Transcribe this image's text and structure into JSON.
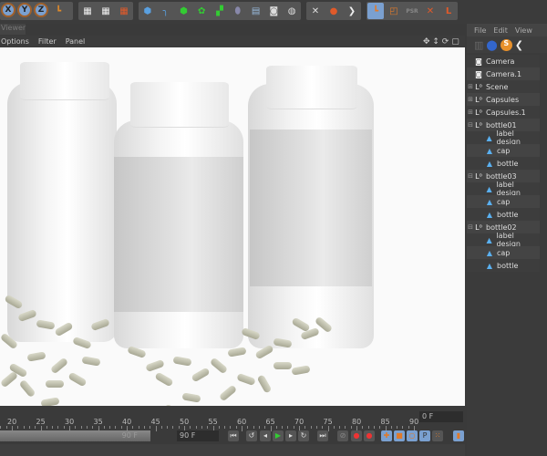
{
  "toolbar": {
    "axis_buttons": [
      "X",
      "Y",
      "Z"
    ],
    "icons": [
      "coordinate-system-icon",
      "render-view-icon",
      "render-picture-viewer-icon",
      "edit-render-settings-icon",
      "cube-icon",
      "spline-pen-icon",
      "subdivision-surface-icon",
      "array-icon",
      "mograph-cloner-icon",
      "deformer-icon",
      "floor-icon",
      "camera-icon",
      "light-icon",
      "snap-icon",
      "workplane-icon",
      "more-arrow-icon",
      "model-mode-icon",
      "texture-mode-icon",
      "psr-icon",
      "axis-mode-icon",
      "workplane-mode-icon"
    ]
  },
  "viewer": {
    "tab": "Viewer",
    "menu": [
      "Options",
      "Filter",
      "Panel"
    ]
  },
  "outliner": {
    "menu": [
      "File",
      "Edit",
      "View"
    ],
    "items": [
      {
        "label": "Camera",
        "icon": "camera-icon",
        "level": 0
      },
      {
        "label": "Camera.1",
        "icon": "camera-icon",
        "level": 0
      },
      {
        "label": "Scene",
        "icon": "null-object-icon",
        "level": 0,
        "expand": "+"
      },
      {
        "label": "Capsules",
        "icon": "null-object-icon",
        "level": 0,
        "expand": "+"
      },
      {
        "label": "Capsules.1",
        "icon": "null-object-icon",
        "level": 0,
        "expand": "+"
      },
      {
        "label": "bottle01",
        "icon": "null-object-icon",
        "level": 0,
        "expand": "-"
      },
      {
        "label": "label design",
        "icon": "polygon-object-icon",
        "level": 1
      },
      {
        "label": "cap",
        "icon": "polygon-object-icon",
        "level": 1
      },
      {
        "label": "bottle",
        "icon": "polygon-object-icon",
        "level": 1
      },
      {
        "label": "bottle03",
        "icon": "null-object-icon",
        "level": 0,
        "expand": "-"
      },
      {
        "label": "label design",
        "icon": "polygon-object-icon",
        "level": 1
      },
      {
        "label": "cap",
        "icon": "polygon-object-icon",
        "level": 1
      },
      {
        "label": "bottle",
        "icon": "polygon-object-icon",
        "level": 1
      },
      {
        "label": "bottle02",
        "icon": "null-object-icon",
        "level": 0,
        "expand": "-"
      },
      {
        "label": "label design",
        "icon": "polygon-object-icon",
        "level": 1
      },
      {
        "label": "cap",
        "icon": "polygon-object-icon",
        "level": 1
      },
      {
        "label": "bottle",
        "icon": "polygon-object-icon",
        "level": 1
      }
    ]
  },
  "timeline": {
    "ticks": [
      20,
      25,
      30,
      35,
      40,
      45,
      50,
      55,
      60,
      65,
      70,
      75,
      80,
      85,
      90
    ],
    "current_frame": "0 F",
    "range_end": "90 F",
    "end_frame": "90 F"
  }
}
